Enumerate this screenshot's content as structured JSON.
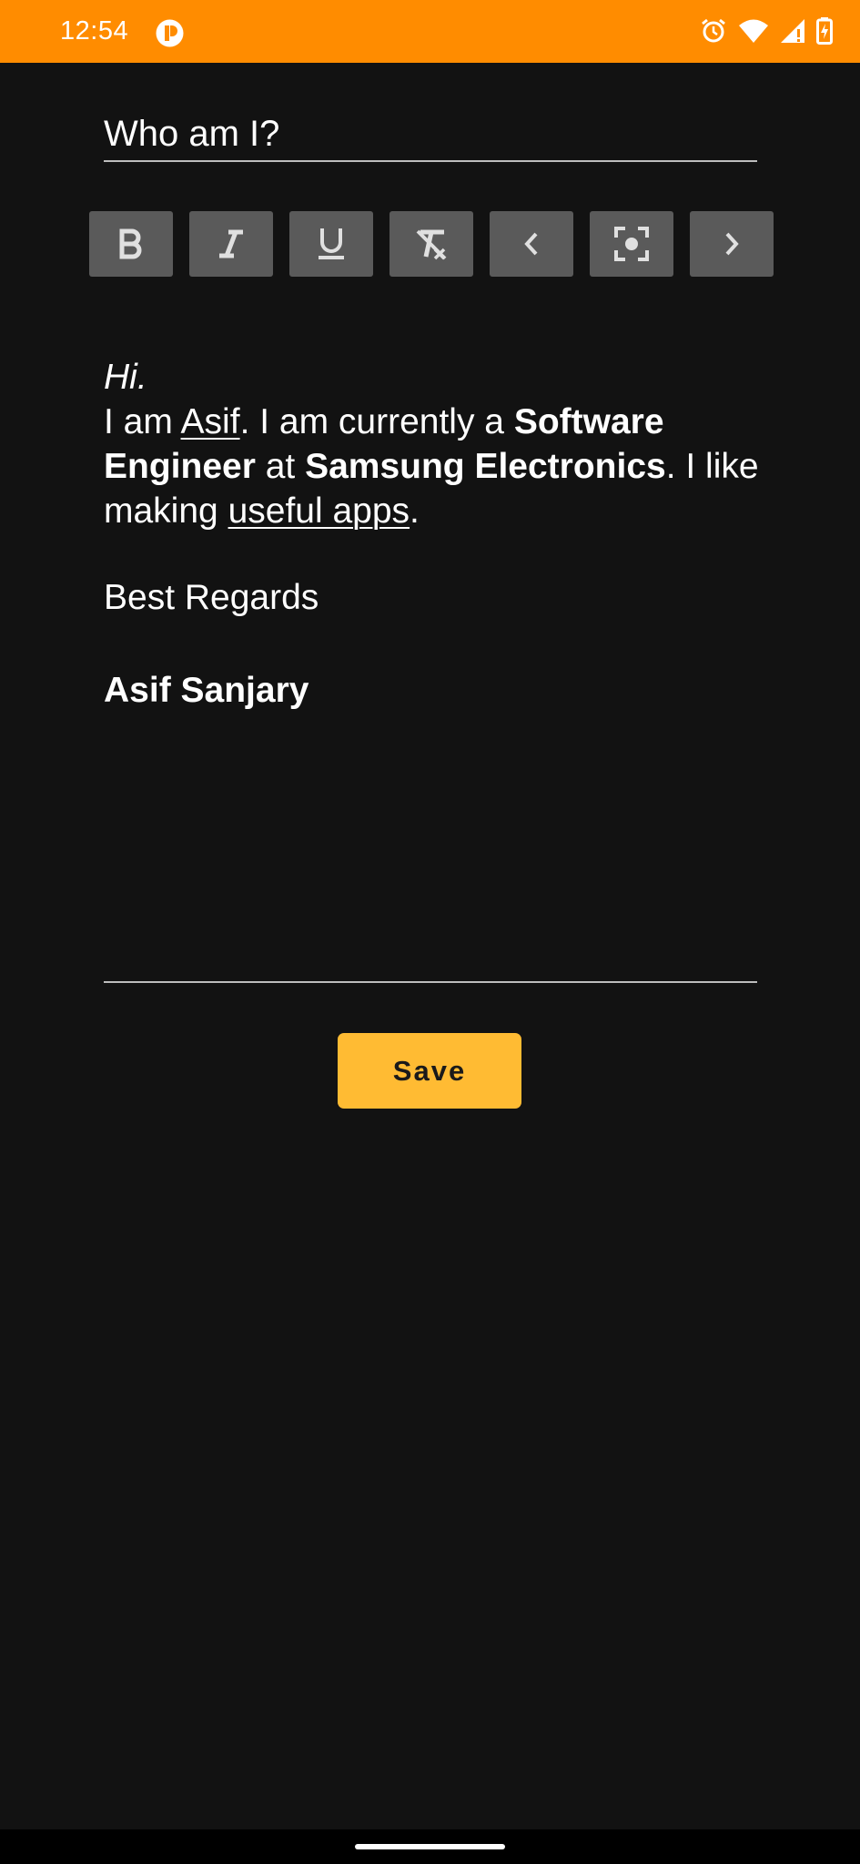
{
  "status_bar": {
    "time": "12:54",
    "background": "#ff8c00",
    "icons": [
      "app-notification-icon",
      "alarm-icon",
      "wifi-icon",
      "signal-icon",
      "battery-charging-icon"
    ]
  },
  "note": {
    "title": "Who am I?",
    "body": {
      "greeting": "Hi.",
      "intro_1": "I am ",
      "name_link": "Asif",
      "intro_2": ". I am currently a ",
      "role": "Software Engineer",
      "intro_3": " at ",
      "company": "Samsung Electronics",
      "intro_4": ". I like making ",
      "apps_link": "useful apps",
      "intro_5": ".",
      "closing": "Best Regards",
      "signature": "Asif Sanjary"
    }
  },
  "toolbar": {
    "buttons": [
      "bold-icon",
      "italic-icon",
      "underline-icon",
      "clear-format-icon",
      "previous-icon",
      "focus-icon",
      "next-icon"
    ]
  },
  "actions": {
    "save_label": "Save",
    "accent": "#ffbb33"
  }
}
